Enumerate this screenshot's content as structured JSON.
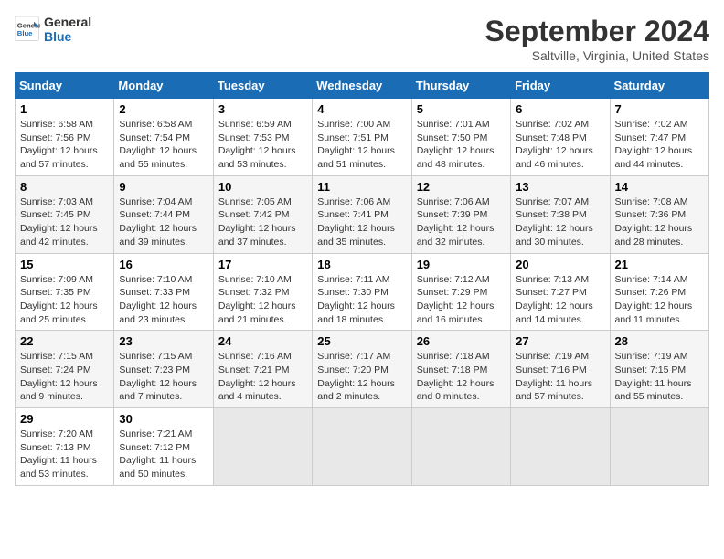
{
  "logo": {
    "line1": "General",
    "line2": "Blue"
  },
  "title": "September 2024",
  "subtitle": "Saltville, Virginia, United States",
  "days_of_week": [
    "Sunday",
    "Monday",
    "Tuesday",
    "Wednesday",
    "Thursday",
    "Friday",
    "Saturday"
  ],
  "weeks": [
    [
      {
        "day": "1",
        "sunrise": "6:58 AM",
        "sunset": "7:56 PM",
        "daylight": "12 hours and 57 minutes."
      },
      {
        "day": "2",
        "sunrise": "6:58 AM",
        "sunset": "7:54 PM",
        "daylight": "12 hours and 55 minutes."
      },
      {
        "day": "3",
        "sunrise": "6:59 AM",
        "sunset": "7:53 PM",
        "daylight": "12 hours and 53 minutes."
      },
      {
        "day": "4",
        "sunrise": "7:00 AM",
        "sunset": "7:51 PM",
        "daylight": "12 hours and 51 minutes."
      },
      {
        "day": "5",
        "sunrise": "7:01 AM",
        "sunset": "7:50 PM",
        "daylight": "12 hours and 48 minutes."
      },
      {
        "day": "6",
        "sunrise": "7:02 AM",
        "sunset": "7:48 PM",
        "daylight": "12 hours and 46 minutes."
      },
      {
        "day": "7",
        "sunrise": "7:02 AM",
        "sunset": "7:47 PM",
        "daylight": "12 hours and 44 minutes."
      }
    ],
    [
      {
        "day": "8",
        "sunrise": "7:03 AM",
        "sunset": "7:45 PM",
        "daylight": "12 hours and 42 minutes."
      },
      {
        "day": "9",
        "sunrise": "7:04 AM",
        "sunset": "7:44 PM",
        "daylight": "12 hours and 39 minutes."
      },
      {
        "day": "10",
        "sunrise": "7:05 AM",
        "sunset": "7:42 PM",
        "daylight": "12 hours and 37 minutes."
      },
      {
        "day": "11",
        "sunrise": "7:06 AM",
        "sunset": "7:41 PM",
        "daylight": "12 hours and 35 minutes."
      },
      {
        "day": "12",
        "sunrise": "7:06 AM",
        "sunset": "7:39 PM",
        "daylight": "12 hours and 32 minutes."
      },
      {
        "day": "13",
        "sunrise": "7:07 AM",
        "sunset": "7:38 PM",
        "daylight": "12 hours and 30 minutes."
      },
      {
        "day": "14",
        "sunrise": "7:08 AM",
        "sunset": "7:36 PM",
        "daylight": "12 hours and 28 minutes."
      }
    ],
    [
      {
        "day": "15",
        "sunrise": "7:09 AM",
        "sunset": "7:35 PM",
        "daylight": "12 hours and 25 minutes."
      },
      {
        "day": "16",
        "sunrise": "7:10 AM",
        "sunset": "7:33 PM",
        "daylight": "12 hours and 23 minutes."
      },
      {
        "day": "17",
        "sunrise": "7:10 AM",
        "sunset": "7:32 PM",
        "daylight": "12 hours and 21 minutes."
      },
      {
        "day": "18",
        "sunrise": "7:11 AM",
        "sunset": "7:30 PM",
        "daylight": "12 hours and 18 minutes."
      },
      {
        "day": "19",
        "sunrise": "7:12 AM",
        "sunset": "7:29 PM",
        "daylight": "12 hours and 16 minutes."
      },
      {
        "day": "20",
        "sunrise": "7:13 AM",
        "sunset": "7:27 PM",
        "daylight": "12 hours and 14 minutes."
      },
      {
        "day": "21",
        "sunrise": "7:14 AM",
        "sunset": "7:26 PM",
        "daylight": "12 hours and 11 minutes."
      }
    ],
    [
      {
        "day": "22",
        "sunrise": "7:15 AM",
        "sunset": "7:24 PM",
        "daylight": "12 hours and 9 minutes."
      },
      {
        "day": "23",
        "sunrise": "7:15 AM",
        "sunset": "7:23 PM",
        "daylight": "12 hours and 7 minutes."
      },
      {
        "day": "24",
        "sunrise": "7:16 AM",
        "sunset": "7:21 PM",
        "daylight": "12 hours and 4 minutes."
      },
      {
        "day": "25",
        "sunrise": "7:17 AM",
        "sunset": "7:20 PM",
        "daylight": "12 hours and 2 minutes."
      },
      {
        "day": "26",
        "sunrise": "7:18 AM",
        "sunset": "7:18 PM",
        "daylight": "12 hours and 0 minutes."
      },
      {
        "day": "27",
        "sunrise": "7:19 AM",
        "sunset": "7:16 PM",
        "daylight": "11 hours and 57 minutes."
      },
      {
        "day": "28",
        "sunrise": "7:19 AM",
        "sunset": "7:15 PM",
        "daylight": "11 hours and 55 minutes."
      }
    ],
    [
      {
        "day": "29",
        "sunrise": "7:20 AM",
        "sunset": "7:13 PM",
        "daylight": "11 hours and 53 minutes."
      },
      {
        "day": "30",
        "sunrise": "7:21 AM",
        "sunset": "7:12 PM",
        "daylight": "11 hours and 50 minutes."
      },
      null,
      null,
      null,
      null,
      null
    ]
  ]
}
